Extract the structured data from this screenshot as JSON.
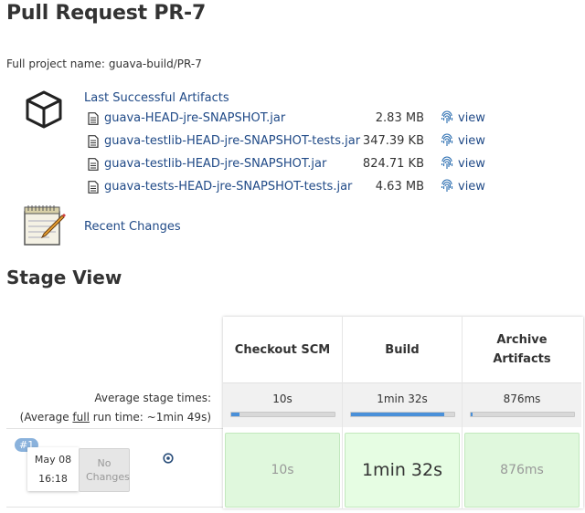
{
  "page": {
    "title": "Pull Request PR-7",
    "full_name_label": "Full project name:",
    "full_name_value": "guava-build/PR-7"
  },
  "artifacts": {
    "title": "Last Successful Artifacts",
    "view_label": "view",
    "items": [
      {
        "name": "guava-HEAD-jre-SNAPSHOT.jar",
        "size": "2.83 MB"
      },
      {
        "name": "guava-testlib-HEAD-jre-SNAPSHOT-tests.jar",
        "size": "347.39 KB"
      },
      {
        "name": "guava-testlib-HEAD-jre-SNAPSHOT.jar",
        "size": "824.71 KB"
      },
      {
        "name": "guava-tests-HEAD-jre-SNAPSHOT-tests.jar",
        "size": "4.63 MB"
      }
    ]
  },
  "changes": {
    "link": "Recent Changes"
  },
  "stage_view": {
    "heading": "Stage View",
    "avg_stage_label": "Average stage times:",
    "avg_run_prefix": "(Average ",
    "avg_run_full": "full",
    "avg_run_suffix": " run time: ~1min 49s)",
    "stages": [
      {
        "name": "Checkout SCM",
        "avg": "10s",
        "progress": 0.08,
        "cell": "10s"
      },
      {
        "name": "Build",
        "avg": "1min 32s",
        "progress": 0.9,
        "cell": "1min 32s"
      },
      {
        "name": "Archive Artifacts",
        "avg": "876ms",
        "progress": 0.02,
        "cell": "876ms"
      }
    ],
    "build": {
      "badge": "#1",
      "date": "May 08",
      "time": "16:18",
      "no_changes": "No Changes"
    }
  },
  "colors": {
    "link": "#204a87",
    "success_cell": "#e0f8dd",
    "progress": "#4a90d9"
  }
}
